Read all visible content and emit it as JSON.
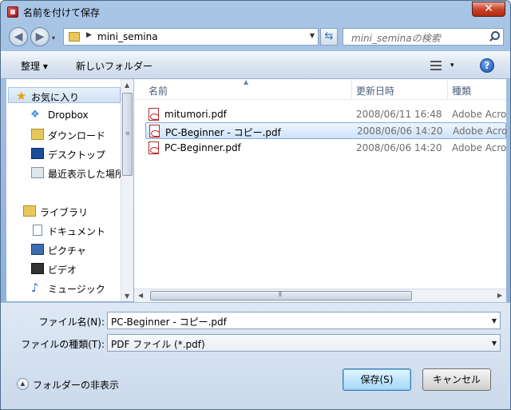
{
  "window": {
    "title": "名前を付けて保存",
    "close_label": "✕"
  },
  "address": {
    "crumb": "mini_semina",
    "search_placeholder": "mini_seminaの検索"
  },
  "toolbar": {
    "organize": "整理 ▾",
    "new_folder": "新しいフォルダー",
    "views_drop": "▾",
    "help": "?"
  },
  "nav": {
    "favorites": "お気に入り",
    "items": [
      "Dropbox",
      "ダウンロード",
      "デスクトップ",
      "最近表示した場所"
    ],
    "libraries": "ライブラリ",
    "library_items": [
      "ドキュメント",
      "ピクチャ",
      "ビデオ",
      "ミュージック"
    ]
  },
  "columns": {
    "name": "名前",
    "date": "更新日時",
    "type": "種類"
  },
  "files": [
    {
      "name": "mitumori.pdf",
      "date": "2008/06/11 16:48",
      "type": "Adobe Acrobat"
    },
    {
      "name": "PC-Beginner - コピー.pdf",
      "date": "2008/06/06 14:20",
      "type": "Adobe Acrobat"
    },
    {
      "name": "PC-Beginner.pdf",
      "date": "2008/06/06 14:20",
      "type": "Adobe Acrobat"
    }
  ],
  "selected_index": 1,
  "form": {
    "filename_label": "ファイル名(N):",
    "filename_value": "PC-Beginner - コピー.pdf",
    "filetype_label": "ファイルの種類(T):",
    "filetype_value": "PDF ファイル (*.pdf)"
  },
  "footer": {
    "hide_folders": "フォルダーの非表示",
    "save": "保存(S)",
    "cancel": "キャンセル"
  }
}
